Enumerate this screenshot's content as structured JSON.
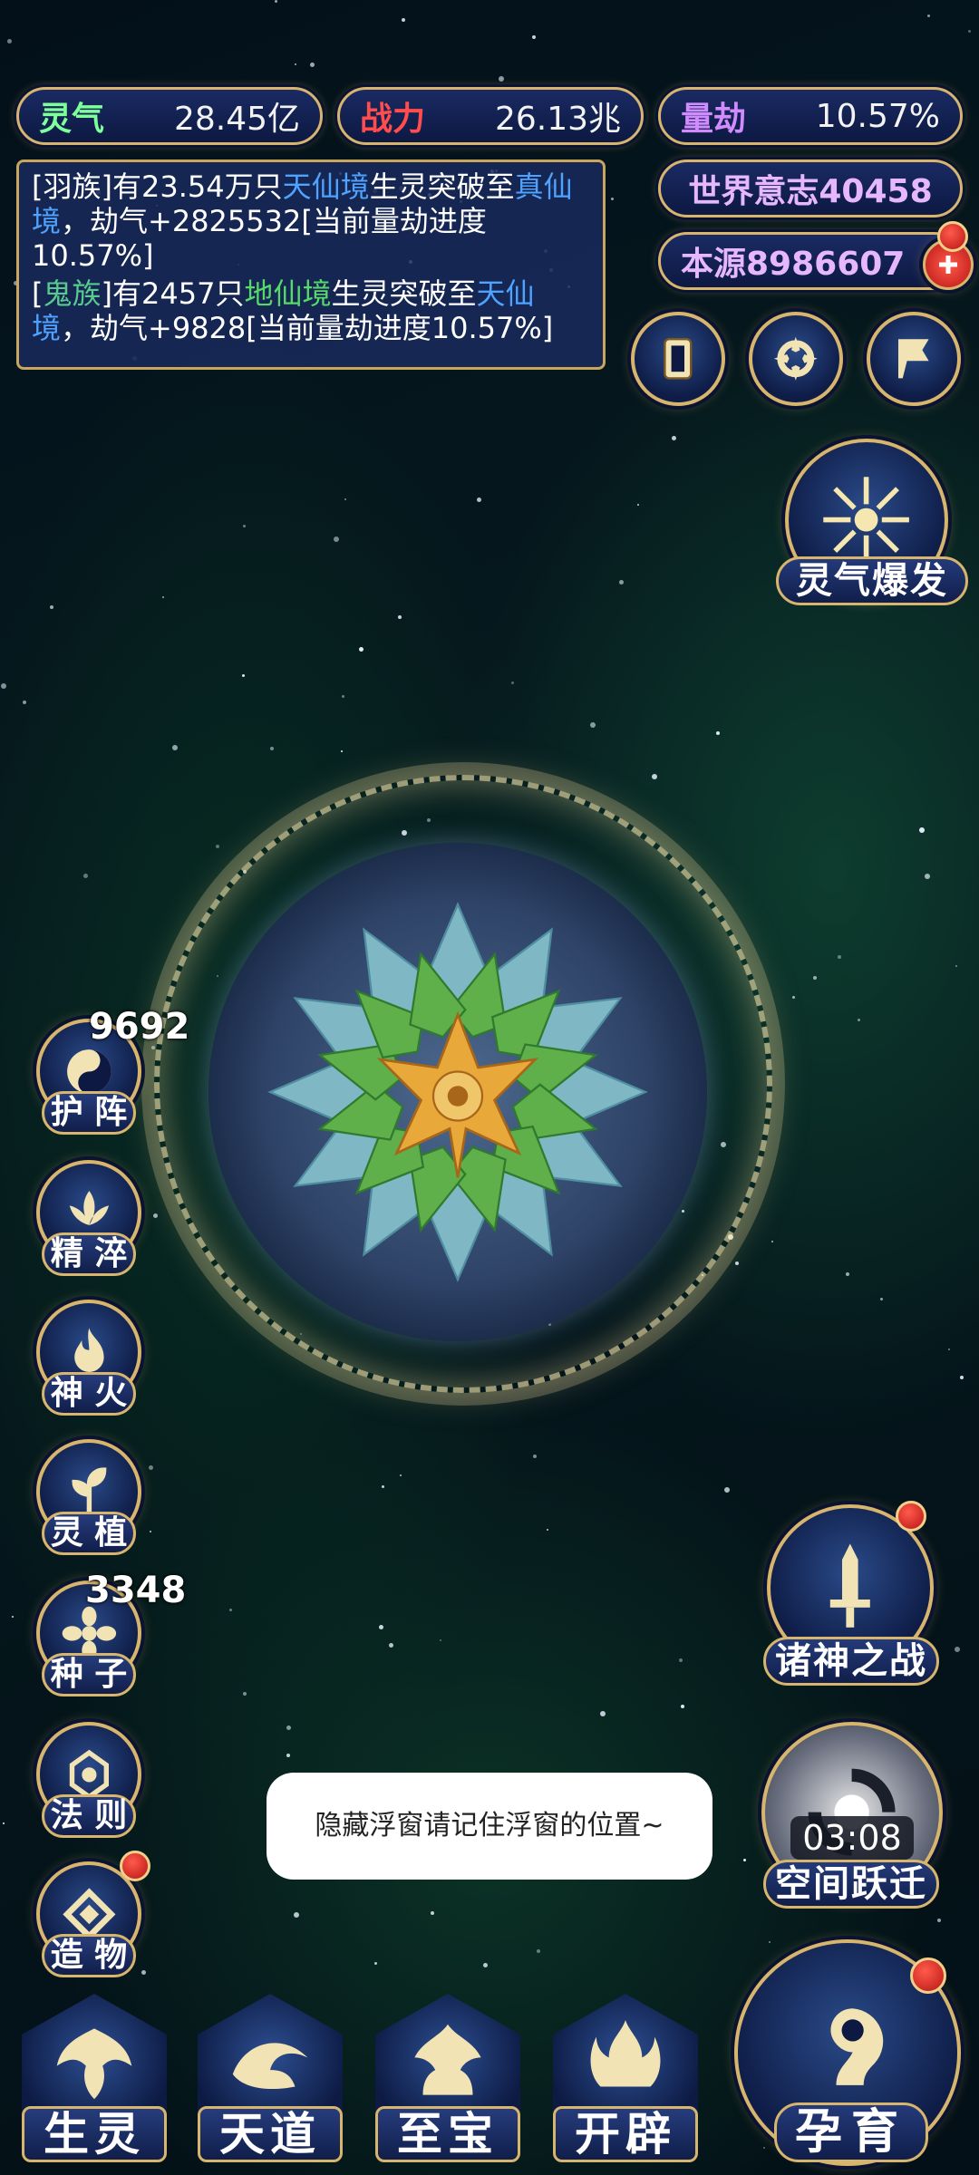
{
  "stats": {
    "lingqi": {
      "label": "灵气",
      "value": "28.45亿",
      "color": "#7dff9a"
    },
    "zhanli": {
      "label": "战力",
      "value": "26.13兆",
      "color": "#ff4d4d"
    },
    "liangjie": {
      "label": "量劫",
      "value": "10.57%",
      "color": "#d08bff"
    },
    "world_will": "世界意志40458",
    "origin": "本源8986607"
  },
  "notices": [
    {
      "prefix": "[羽族]有23.54万只",
      "realm1": "天仙境",
      "mid": "生灵突破至",
      "realm2": "真仙境",
      "suffix": "，劫气+2825532[当前量劫进度10.57%]"
    },
    {
      "race": "鬼族",
      "mid1": "有2457只",
      "realm1": "地仙境",
      "mid": "生灵突破至",
      "realm2": "天仙境",
      "suffix": "，劫气+9828[当前量劫进度10.57%]"
    }
  ],
  "top_icons": [
    "card-icon",
    "vortex-icon",
    "flag-icon"
  ],
  "burst_label": "灵气爆发",
  "side_menu": [
    {
      "label": "护 阵",
      "icon": "yin-yang-icon",
      "count": "9692"
    },
    {
      "label": "精 淬",
      "icon": "lotus-icon"
    },
    {
      "label": "神 火",
      "icon": "flame-icon"
    },
    {
      "label": "灵 植",
      "icon": "plant-icon"
    },
    {
      "label": "种 子",
      "icon": "seed-icon",
      "count": "3348"
    },
    {
      "label": "法 则",
      "icon": "rune-icon"
    },
    {
      "label": "造 物",
      "icon": "creation-icon",
      "badge": true
    }
  ],
  "right_menu": {
    "gods_war": "诸神之战",
    "space_jump": "空间跃迁",
    "timer": "03:08"
  },
  "bottom_nav": [
    {
      "label": "生灵",
      "icon": "phoenix-icon"
    },
    {
      "label": "天道",
      "icon": "wave-icon"
    },
    {
      "label": "至宝",
      "icon": "treasure-icon"
    },
    {
      "label": "开辟",
      "icon": "flame-pillar-icon"
    },
    {
      "label": "孕育",
      "icon": "embryo-icon"
    }
  ],
  "toast": "隐藏浮窗请记住浮窗的位置~"
}
